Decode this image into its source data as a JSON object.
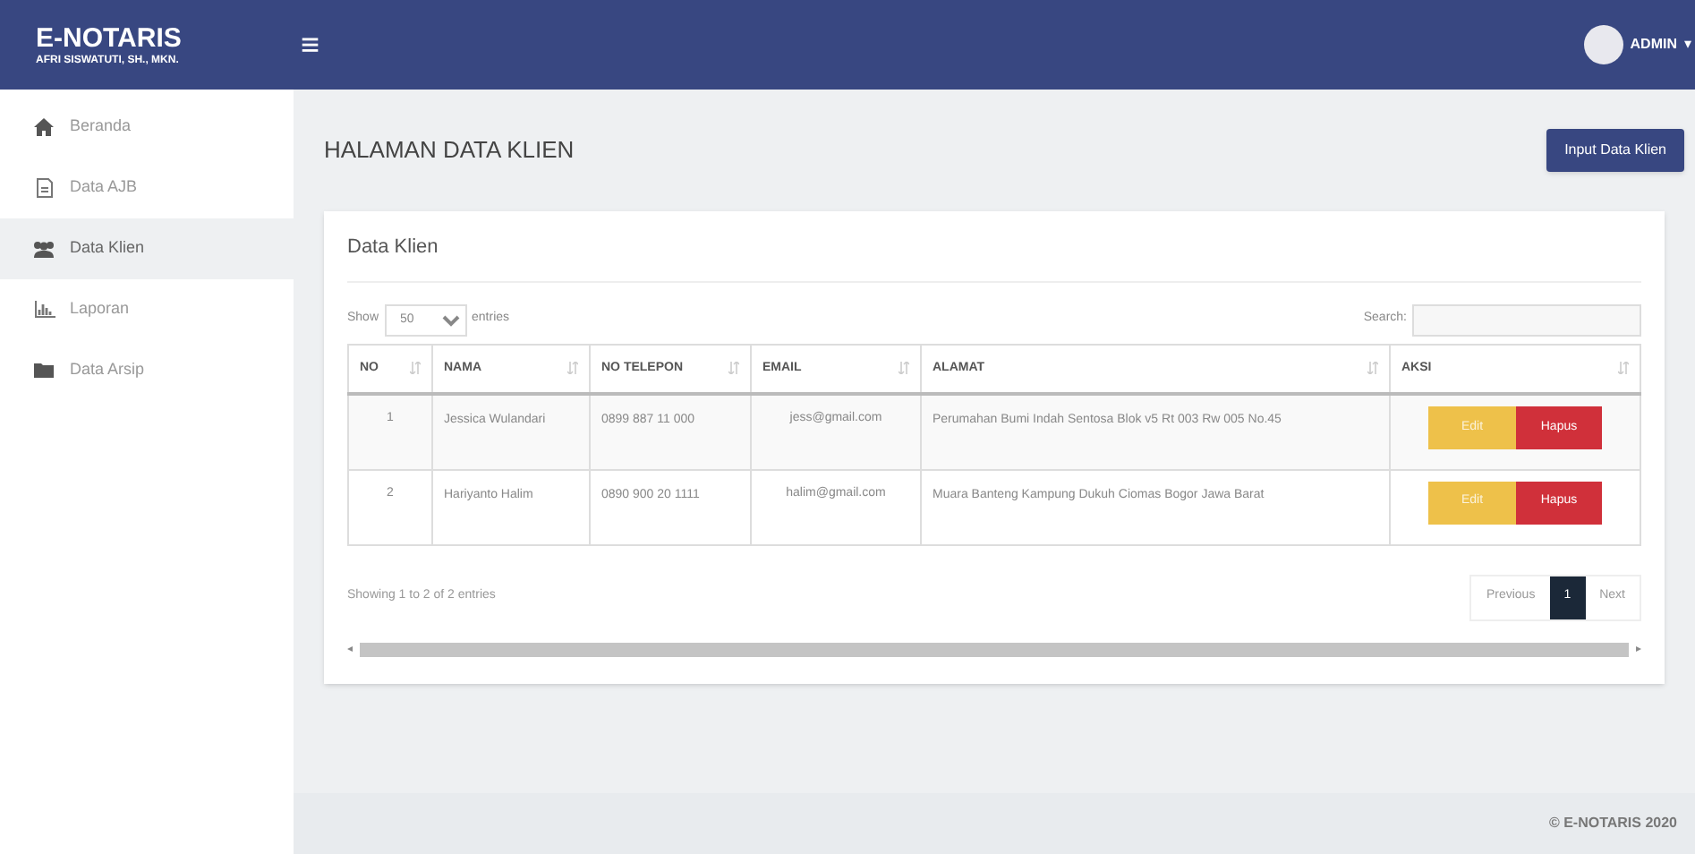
{
  "brand": {
    "title": "E-NOTARIS",
    "subtitle": "AFRI SISWATUTI, SH., MKN."
  },
  "menu_toggle": "≡",
  "user": {
    "name": "ADMIN",
    "caret": "▾"
  },
  "sidebar": {
    "items": [
      {
        "label": "Beranda",
        "selected": false
      },
      {
        "label": "Data AJB",
        "selected": false
      },
      {
        "label": "Data Klien",
        "selected": true
      },
      {
        "label": "Laporan",
        "selected": false
      },
      {
        "label": "Data Arsip",
        "selected": false
      }
    ]
  },
  "page": {
    "title": "HALAMAN DATA KLIEN",
    "action_button": "Input Data Klien"
  },
  "card": {
    "title": "Data Klien",
    "length": {
      "before": "Show",
      "value": "50",
      "after": "entries"
    },
    "search": {
      "label": "Search:"
    },
    "table": {
      "columns": [
        {
          "label": "NO"
        },
        {
          "label": "NAMA"
        },
        {
          "label": "NO TELEPON"
        },
        {
          "label": "EMAIL"
        },
        {
          "label": "ALAMAT"
        },
        {
          "label": "AKSI"
        }
      ],
      "rows": [
        {
          "no": "1",
          "nama": "Jessica Wulandari",
          "telepon": "0899 887 11 000",
          "email": "jess@gmail.com",
          "alamat": "Perumahan Bumi Indah Sentosa Blok v5 Rt 003 Rw 005 No.45",
          "actions": [
            "Edit",
            "Hapus"
          ]
        },
        {
          "no": "2",
          "nama": "Hariyanto Halim",
          "telepon": "0890 900 20 1111",
          "email": "halim@gmail.com",
          "alamat": "Muara Banteng Kampung Dukuh Ciomas Bogor Jawa Barat",
          "actions": [
            "Edit",
            "Hapus"
          ]
        }
      ]
    },
    "info": "Showing 1 to 2 of 2 entries",
    "pagination": [
      {
        "label": "Previous",
        "selected": false
      },
      {
        "label": "1",
        "selected": true
      },
      {
        "label": "Next",
        "selected": false
      }
    ],
    "scroll_left": "◂",
    "scroll_right": "▸"
  },
  "footer": "© E-NOTARIS 2020"
}
